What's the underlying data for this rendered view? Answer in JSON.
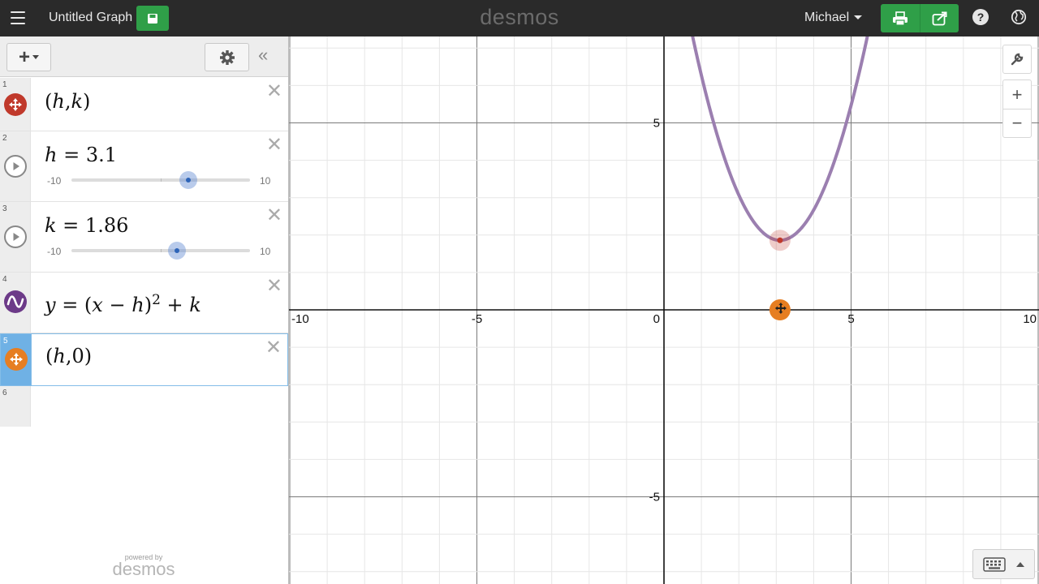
{
  "header": {
    "graph_title": "Untitled Graph",
    "brand": "desmos",
    "user_name": "Michael",
    "icons": [
      "menu-icon",
      "save-icon",
      "print-icon",
      "share-icon",
      "help-icon",
      "globe-icon"
    ],
    "help_glyph": "?"
  },
  "panel": {
    "add_glyph": "+",
    "collapse_glyph": "«",
    "expressions": [
      {
        "number": "1",
        "type": "point",
        "latex": "(h,k)",
        "color": "#c0392b",
        "icon": "move-point-icon"
      },
      {
        "number": "2",
        "type": "slider",
        "variable": "h",
        "value": "3.1",
        "min": "-10",
        "max": "10",
        "icon": "play-icon"
      },
      {
        "number": "3",
        "type": "slider",
        "variable": "k",
        "value": "1.86",
        "min": "-10",
        "max": "10",
        "icon": "play-icon"
      },
      {
        "number": "4",
        "type": "function",
        "latex": "y=(x−h)^2+k",
        "color": "#6c3a88",
        "icon": "wave-icon"
      },
      {
        "number": "5",
        "type": "point",
        "latex": "(h,0)",
        "color": "#e67e22",
        "icon": "move-point-icon",
        "selected": true
      },
      {
        "number": "6",
        "type": "empty"
      }
    ],
    "powered_by": "powered by",
    "powered_brand": "desmos"
  },
  "graph": {
    "x_range": [
      -10,
      10
    ],
    "y_range": [
      -7.3,
      7.3
    ],
    "x_tick_labels": [
      "-10",
      "-5",
      "0",
      "5",
      "10"
    ],
    "y_tick_labels": [
      "5",
      "-5"
    ],
    "grid": true,
    "h": 3.1,
    "k": 1.86,
    "curve_color": "#9b7fb0",
    "vertex_color": "#c0392b",
    "root_point_color": "#e67e22",
    "buttons": [
      "wrench-icon",
      "zoom-in-icon",
      "zoom-out-icon",
      "keyboard-icon"
    ]
  }
}
